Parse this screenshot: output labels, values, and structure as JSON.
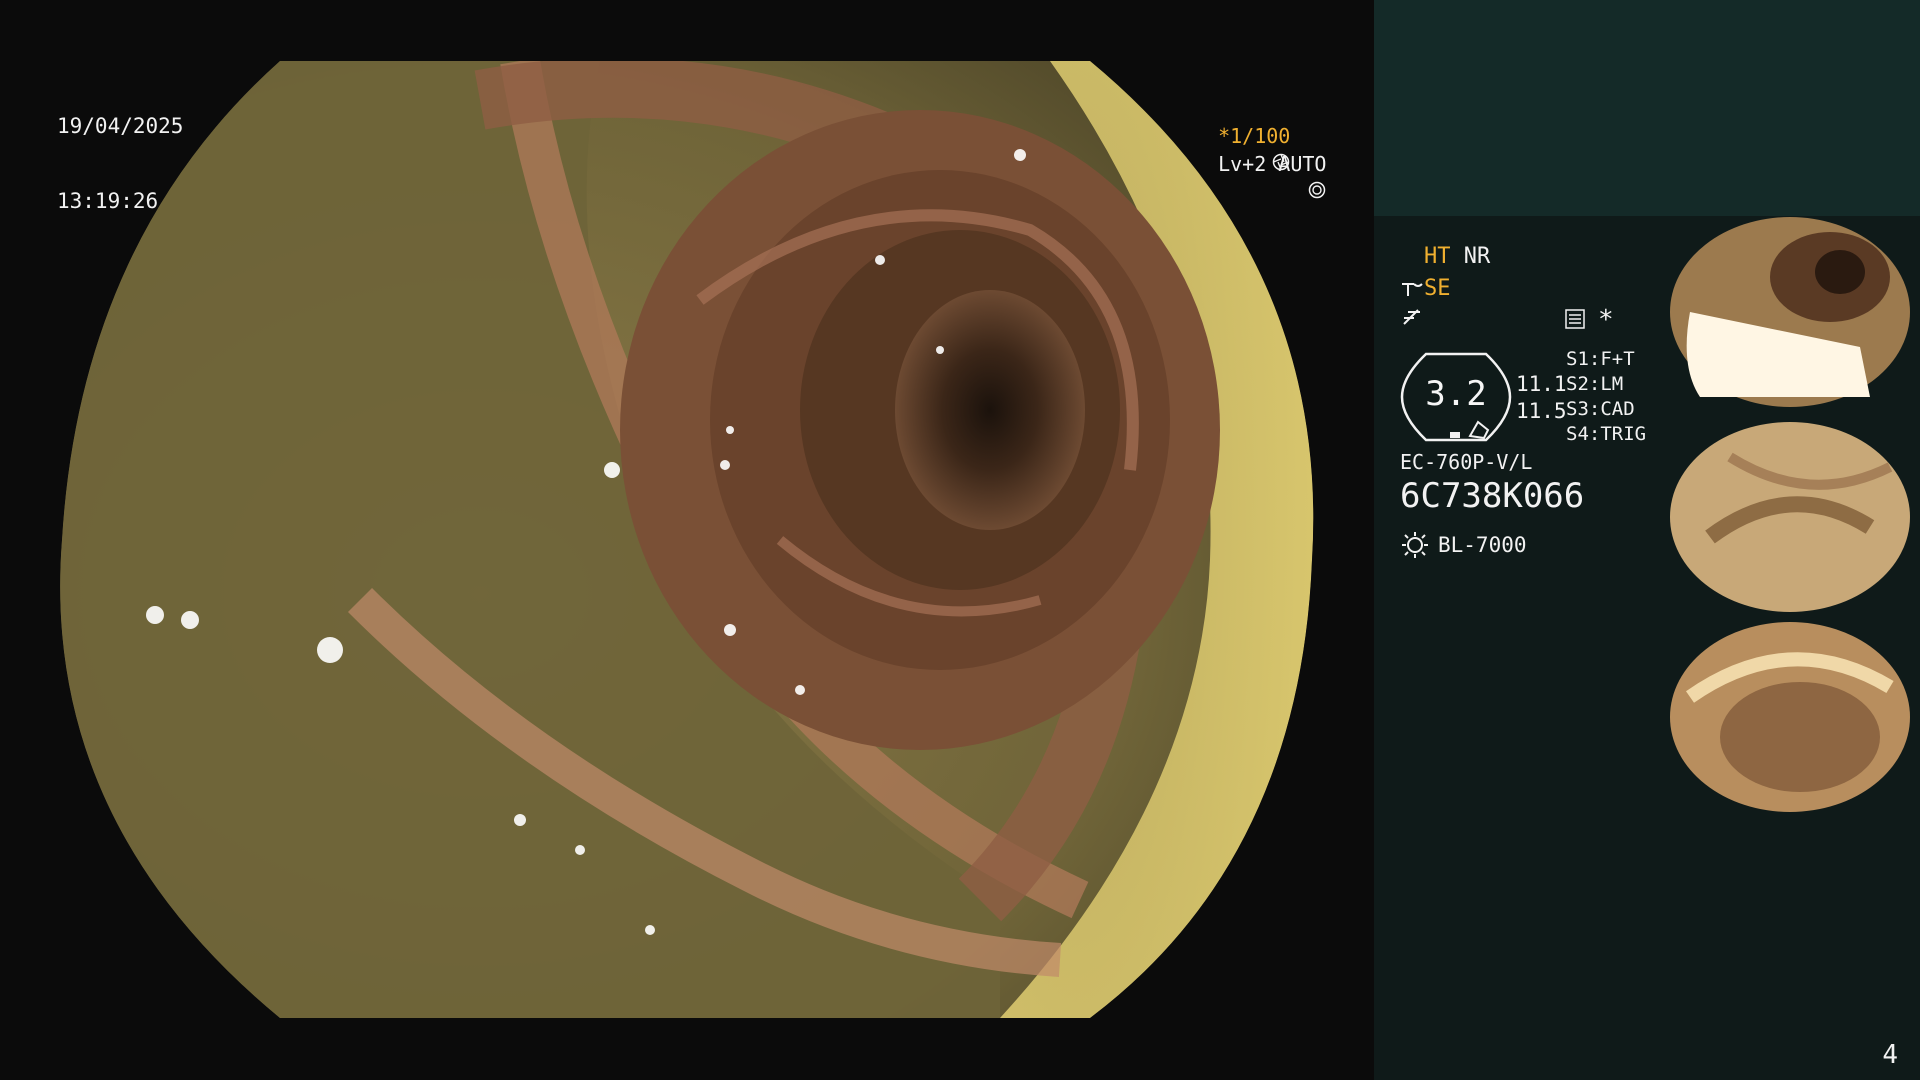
{
  "osd": {
    "date": "19/04/2025",
    "time": "13:19:26",
    "shutter_prefix": "*",
    "shutter_value": "1/100",
    "level": "Lv+2 AUTO"
  },
  "panel": {
    "ht": "HT",
    "nr": "NR",
    "se": "SE",
    "hex_value": "3.2",
    "val_a": "11.1",
    "val_b": "11.5",
    "s1": "S1:F+T",
    "s2": "S2:LM",
    "s3": "S3:CAD",
    "s4": "S4:TRIG",
    "scope_model": "EC-760P-V/L",
    "serial": "6C738K066",
    "light_source": "BL-7000",
    "asterisk": "*"
  },
  "page_number": "4",
  "colors": {
    "panel_top": "#142a28",
    "panel_body": "#0f1a19",
    "accent_orange": "#f0b030"
  }
}
